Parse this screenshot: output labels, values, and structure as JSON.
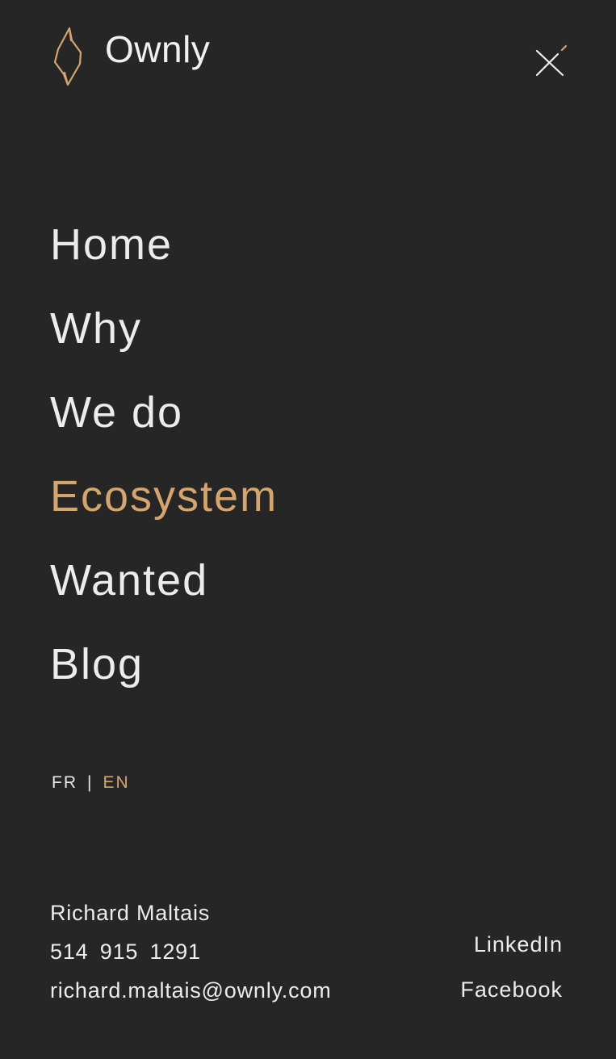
{
  "brand": {
    "name": "Ownly",
    "accent_color": "#d4a66e",
    "logo_icon": "lightning-bolt-icon"
  },
  "header": {
    "close_icon": "close-icon"
  },
  "menu": {
    "items": [
      {
        "label": "Home",
        "active": false
      },
      {
        "label": "Why",
        "active": false
      },
      {
        "label": "We do",
        "active": false
      },
      {
        "label": "Ecosystem",
        "active": true
      },
      {
        "label": "Wanted",
        "active": false
      },
      {
        "label": "Blog",
        "active": false
      }
    ]
  },
  "language": {
    "fr": "FR",
    "separator": "|",
    "en": "EN",
    "selected": "EN"
  },
  "contact": {
    "name": "Richard Maltais",
    "phone": "514 915 1291",
    "email": "richard.maltais@ownly.com"
  },
  "social": {
    "linkedin": "LinkedIn",
    "facebook": "Facebook"
  },
  "colors": {
    "background": "#262626",
    "text": "#ececec",
    "accent": "#d4a66e"
  }
}
